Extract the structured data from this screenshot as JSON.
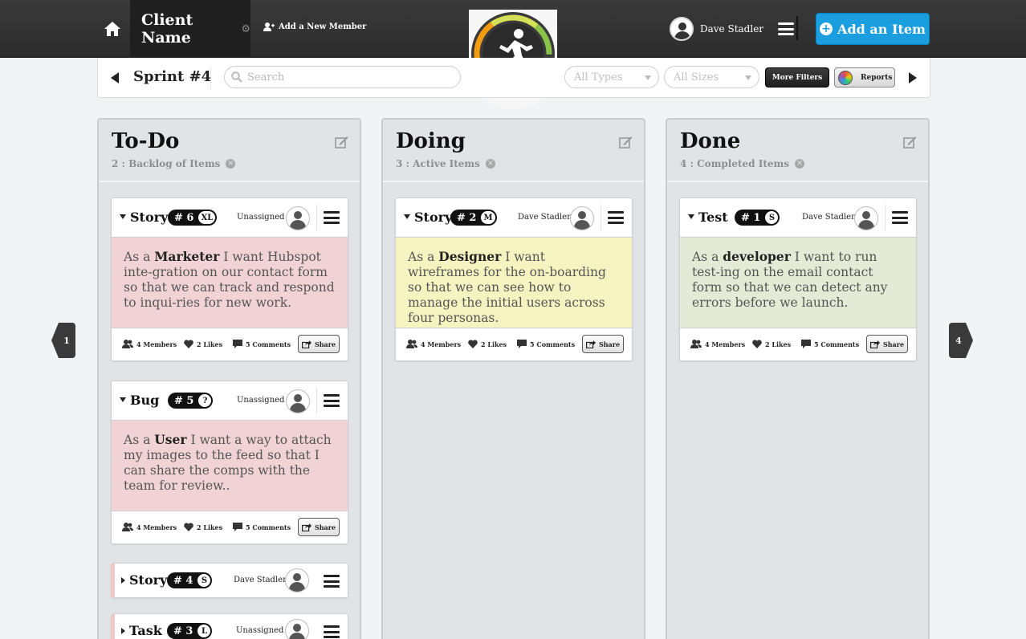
{
  "header": {
    "client_name": "Client Name",
    "add_member_label": "Add a New Member",
    "user_name": "Dave Stadler",
    "add_item_label": "Add an Item",
    "accent_color": "#1a9ee0"
  },
  "subbar": {
    "sprint_title": "Sprint #4",
    "search_placeholder": "Search",
    "types_select": "All Types",
    "sizes_select": "All Sizes",
    "more_filters_label": "More Filters",
    "reports_label": "Reports"
  },
  "nav": {
    "prev_count": "1",
    "next_count": "4"
  },
  "columns": [
    {
      "title": "To-Do",
      "subtitle": "2 : Backlog of Items",
      "cards": [
        {
          "type": "Story",
          "number": "# 6",
          "size": "XL",
          "assignee": "Unassigned",
          "role": "Marketer",
          "pre": "As a ",
          "post": " I want Hubspot inte-gration on our contact form so that we can track and respond to inqui-ries for new work.",
          "members": "4 Members",
          "likes": "2 Likes",
          "comments": "5 Comments",
          "share": "Share",
          "color": "#f1d3d5"
        },
        {
          "type": "Bug",
          "number": "# 5",
          "size": "?",
          "assignee": "Unassigned",
          "role": "User",
          "pre": "As a ",
          "post": " I want a way to attach my images to the feed so that I can share the comps with the team for review..",
          "members": "4 Members",
          "likes": "2 Likes",
          "comments": "5 Comments",
          "share": "Share",
          "color": "#f1d3d5"
        },
        {
          "type": "Story",
          "number": "# 4",
          "size": "S",
          "assignee": "Dave Stadler"
        },
        {
          "type": "Task",
          "number": "# 3",
          "size": "L",
          "assignee": "Unassigned"
        }
      ]
    },
    {
      "title": "Doing",
      "subtitle": "3 : Active Items",
      "cards": [
        {
          "type": "Story",
          "number": "# 2",
          "size": "M",
          "assignee": "Dave Stadler",
          "role": "Designer",
          "pre": "As a ",
          "post": " I want wireframes for the on-boarding so that we can see how to manage the initial users across four personas.",
          "members": "4 Members",
          "likes": "2 Likes",
          "comments": "5 Comments",
          "share": "Share",
          "color": "#f5f3c0"
        }
      ]
    },
    {
      "title": "Done",
      "subtitle": "4 :  Completed Items",
      "cards": [
        {
          "type": "Test",
          "number": "# 1",
          "size": "S",
          "assignee": "Dave Stadler",
          "role": "developer",
          "pre": "As a ",
          "post": " I want to run test-ing on the email contact form so that we can detect any errors before we launch.",
          "members": "4 Members",
          "likes": "2 Likes",
          "comments": "5 Comments",
          "share": "Share",
          "color": "#e3ebd6"
        }
      ]
    }
  ]
}
